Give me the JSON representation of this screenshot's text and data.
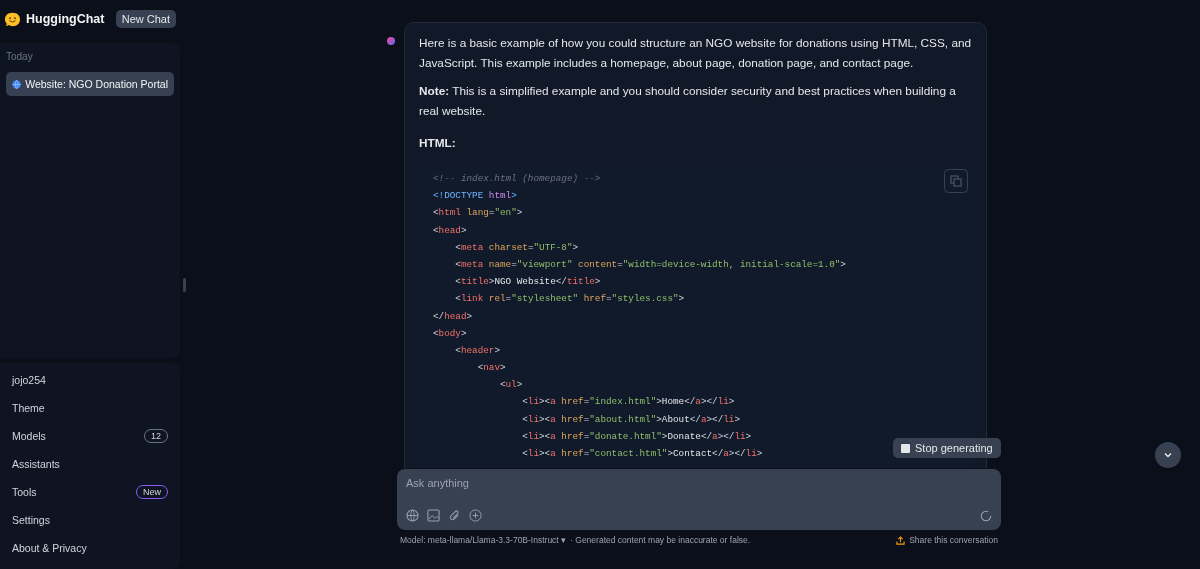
{
  "sidebar": {
    "app_name": "HuggingChat",
    "new_chat_button": "New Chat",
    "group_label": "Today",
    "conversations": [
      {
        "title": "Website: NGO Donation Portal",
        "selected": true
      }
    ],
    "user": "jojo254",
    "menu": [
      {
        "label": "Theme"
      },
      {
        "label": "Models",
        "badge": "12",
        "color": "#6b7280"
      },
      {
        "label": "Assistants"
      },
      {
        "label": "Tools",
        "badge": "New",
        "color": "#8b5cf6"
      },
      {
        "label": "Settings"
      },
      {
        "label": "About & Privacy"
      }
    ]
  },
  "message": {
    "paragraphs": [
      {
        "kind": "text",
        "text": "Here is a basic example of how you could structure an NGO website for donations using HTML, CSS, and JavaScript. This example includes a homepage, about page, donation page, and contact page."
      },
      {
        "kind": "text",
        "text": "**Note:** This is a simplified example and you should consider security and best practices when building a real website."
      },
      {
        "kind": "heading",
        "text": "HTML:"
      }
    ],
    "code_lines": [
      [
        {
          "kind": "comment",
          "text": "<!-- index.html (homepage) -->"
        }
      ],
      [
        {
          "kind": "keyword",
          "text": "<!DOCTYPE"
        },
        {
          "kind": "doctag",
          "text": " html"
        },
        {
          "kind": "keyword",
          "text": ">"
        }
      ],
      [
        {
          "kind": "punct",
          "text": "<"
        },
        {
          "kind": "tag",
          "text": "html"
        },
        {
          "kind": "attr",
          "text": " lang"
        },
        {
          "kind": "punct",
          "text": "="
        },
        {
          "kind": "string",
          "text": "\"en\""
        },
        {
          "kind": "punct",
          "text": ">"
        }
      ],
      [
        {
          "kind": "punct",
          "text": "<"
        },
        {
          "kind": "tag",
          "text": "head"
        },
        {
          "kind": "punct",
          "text": ">"
        }
      ],
      [
        {
          "kind": "punct",
          "text": "    <"
        },
        {
          "kind": "tag",
          "text": "meta"
        },
        {
          "kind": "attr",
          "text": " charset"
        },
        {
          "kind": "punct",
          "text": "="
        },
        {
          "kind": "string",
          "text": "\"UTF-8\""
        },
        {
          "kind": "punct",
          "text": ">"
        }
      ],
      [
        {
          "kind": "punct",
          "text": "    <"
        },
        {
          "kind": "tag",
          "text": "meta"
        },
        {
          "kind": "attr",
          "text": " name"
        },
        {
          "kind": "punct",
          "text": "="
        },
        {
          "kind": "string",
          "text": "\"viewport\""
        },
        {
          "kind": "attr",
          "text": " content"
        },
        {
          "kind": "punct",
          "text": "="
        },
        {
          "kind": "string",
          "text": "\"width=device-width, initial-scale=1.0\""
        },
        {
          "kind": "punct",
          "text": ">"
        }
      ],
      [
        {
          "kind": "punct",
          "text": "    <"
        },
        {
          "kind": "tag",
          "text": "title"
        },
        {
          "kind": "punct",
          "text": ">"
        },
        {
          "kind": "text",
          "text": "NGO Website"
        },
        {
          "kind": "punct",
          "text": "</"
        },
        {
          "kind": "tag",
          "text": "title"
        },
        {
          "kind": "punct",
          "text": ">"
        }
      ],
      [
        {
          "kind": "punct",
          "text": "    <"
        },
        {
          "kind": "tag",
          "text": "link"
        },
        {
          "kind": "attr",
          "text": " rel"
        },
        {
          "kind": "punct",
          "text": "="
        },
        {
          "kind": "string",
          "text": "\"stylesheet\""
        },
        {
          "kind": "attr",
          "text": " href"
        },
        {
          "kind": "punct",
          "text": "="
        },
        {
          "kind": "string",
          "text": "\"styles.css\""
        },
        {
          "kind": "punct",
          "text": ">"
        }
      ],
      [
        {
          "kind": "punct",
          "text": "</"
        },
        {
          "kind": "tag",
          "text": "head"
        },
        {
          "kind": "punct",
          "text": ">"
        }
      ],
      [
        {
          "kind": "punct",
          "text": "<"
        },
        {
          "kind": "tag",
          "text": "body"
        },
        {
          "kind": "punct",
          "text": ">"
        }
      ],
      [
        {
          "kind": "punct",
          "text": "    <"
        },
        {
          "kind": "tag",
          "text": "header"
        },
        {
          "kind": "punct",
          "text": ">"
        }
      ],
      [
        {
          "kind": "punct",
          "text": "        <"
        },
        {
          "kind": "tag",
          "text": "nav"
        },
        {
          "kind": "punct",
          "text": ">"
        }
      ],
      [
        {
          "kind": "punct",
          "text": "            <"
        },
        {
          "kind": "tag",
          "text": "ul"
        },
        {
          "kind": "punct",
          "text": ">"
        }
      ],
      [
        {
          "kind": "punct",
          "text": "                <"
        },
        {
          "kind": "tag",
          "text": "li"
        },
        {
          "kind": "punct",
          "text": "><"
        },
        {
          "kind": "tag",
          "text": "a"
        },
        {
          "kind": "attr",
          "text": " href"
        },
        {
          "kind": "punct",
          "text": "="
        },
        {
          "kind": "string",
          "text": "\"index.html\""
        },
        {
          "kind": "punct",
          "text": ">"
        },
        {
          "kind": "text",
          "text": "Home"
        },
        {
          "kind": "punct",
          "text": "</"
        },
        {
          "kind": "tag",
          "text": "a"
        },
        {
          "kind": "punct",
          "text": "></"
        },
        {
          "kind": "tag",
          "text": "li"
        },
        {
          "kind": "punct",
          "text": ">"
        }
      ],
      [
        {
          "kind": "punct",
          "text": "                <"
        },
        {
          "kind": "tag",
          "text": "li"
        },
        {
          "kind": "punct",
          "text": "><"
        },
        {
          "kind": "tag",
          "text": "a"
        },
        {
          "kind": "attr",
          "text": " href"
        },
        {
          "kind": "punct",
          "text": "="
        },
        {
          "kind": "string",
          "text": "\"about.html\""
        },
        {
          "kind": "punct",
          "text": ">"
        },
        {
          "kind": "text",
          "text": "About"
        },
        {
          "kind": "punct",
          "text": "</"
        },
        {
          "kind": "tag",
          "text": "a"
        },
        {
          "kind": "punct",
          "text": "></"
        },
        {
          "kind": "tag",
          "text": "li"
        },
        {
          "kind": "punct",
          "text": ">"
        }
      ],
      [
        {
          "kind": "punct",
          "text": "                <"
        },
        {
          "kind": "tag",
          "text": "li"
        },
        {
          "kind": "punct",
          "text": "><"
        },
        {
          "kind": "tag",
          "text": "a"
        },
        {
          "kind": "attr",
          "text": " href"
        },
        {
          "kind": "punct",
          "text": "="
        },
        {
          "kind": "string",
          "text": "\"donate.html\""
        },
        {
          "kind": "punct",
          "text": ">"
        },
        {
          "kind": "text",
          "text": "Donate"
        },
        {
          "kind": "punct",
          "text": "</"
        },
        {
          "kind": "tag",
          "text": "a"
        },
        {
          "kind": "punct",
          "text": "></"
        },
        {
          "kind": "tag",
          "text": "li"
        },
        {
          "kind": "punct",
          "text": ">"
        }
      ],
      [
        {
          "kind": "punct",
          "text": "                <"
        },
        {
          "kind": "tag",
          "text": "li"
        },
        {
          "kind": "punct",
          "text": "><"
        },
        {
          "kind": "tag",
          "text": "a"
        },
        {
          "kind": "attr",
          "text": " href"
        },
        {
          "kind": "punct",
          "text": "="
        },
        {
          "kind": "string",
          "text": "\"contact.html\""
        },
        {
          "kind": "punct",
          "text": ">"
        },
        {
          "kind": "text",
          "text": "Contact"
        },
        {
          "kind": "punct",
          "text": "</"
        },
        {
          "kind": "tag",
          "text": "a"
        },
        {
          "kind": "punct",
          "text": "></"
        },
        {
          "kind": "tag",
          "text": "li"
        },
        {
          "kind": "punct",
          "text": ">"
        }
      ]
    ]
  },
  "stop_button": "Stop generating",
  "composer": {
    "placeholder": "Ask anything"
  },
  "footer": {
    "model": "Model: meta-llama/Llama-3.3-70B-Instruct ▾",
    "disclaimer": "· Generated content may be inaccurate or false.",
    "share_link": "Share this conversation"
  }
}
